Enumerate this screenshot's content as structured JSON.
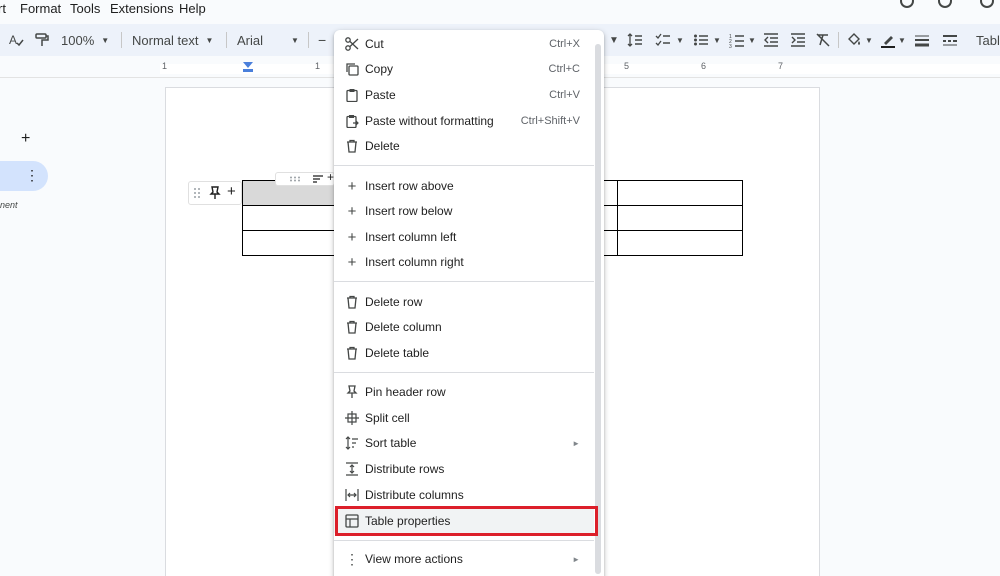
{
  "menubar": {
    "items": [
      "rt",
      "Format",
      "Tools",
      "Extensions",
      "Help"
    ]
  },
  "toolbar": {
    "zoom": "100%",
    "style": "Normal text",
    "font": "Arial",
    "table_label": "Tabl"
  },
  "ruler": {
    "ticks": [
      "1",
      "1",
      "5",
      "6",
      "7"
    ]
  },
  "left_panel": {
    "partial_text": "nent"
  },
  "context_menu": {
    "group1": [
      {
        "label": "Cut",
        "shortcut": "Ctrl+X",
        "icon": "scissors-icon"
      },
      {
        "label": "Copy",
        "shortcut": "Ctrl+C",
        "icon": "copy-icon"
      },
      {
        "label": "Paste",
        "shortcut": "Ctrl+V",
        "icon": "clipboard-icon"
      },
      {
        "label": "Paste without formatting",
        "shortcut": "Ctrl+Shift+V",
        "icon": "paste-plain-icon"
      },
      {
        "label": "Delete",
        "shortcut": "",
        "icon": "trash-icon"
      }
    ],
    "group2": [
      {
        "label": "Insert row above",
        "icon": "plus-icon"
      },
      {
        "label": "Insert row below",
        "icon": "plus-icon"
      },
      {
        "label": "Insert column left",
        "icon": "plus-icon"
      },
      {
        "label": "Insert column right",
        "icon": "plus-icon"
      }
    ],
    "group3": [
      {
        "label": "Delete row",
        "icon": "trash-icon"
      },
      {
        "label": "Delete column",
        "icon": "trash-icon"
      },
      {
        "label": "Delete table",
        "icon": "trash-icon"
      }
    ],
    "group4": [
      {
        "label": "Pin header row",
        "icon": "pin-icon"
      },
      {
        "label": "Split cell",
        "icon": "split-cell-icon"
      },
      {
        "label": "Sort table",
        "icon": "sort-icon",
        "submenu": true
      },
      {
        "label": "Distribute rows",
        "icon": "distribute-rows-icon"
      },
      {
        "label": "Distribute columns",
        "icon": "distribute-columns-icon"
      },
      {
        "label": "Table properties",
        "icon": "table-icon",
        "highlighted": true
      }
    ],
    "group5": [
      {
        "label": "View more actions",
        "icon": "more-vert-icon",
        "submenu": true
      }
    ],
    "submenu_arrow": "►"
  },
  "colors": {
    "highlight_box": "#dc1f2a",
    "accent_blue": "#4a7fdb",
    "tab_pill": "#d3e3fd"
  }
}
